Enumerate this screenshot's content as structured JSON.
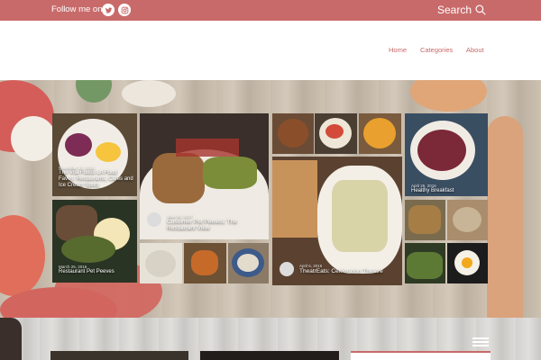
{
  "topbar": {
    "follow_label": "Follow me on",
    "social": [
      "twitter-icon",
      "instagram-icon"
    ],
    "search_label": "Search",
    "bg_color": "#c96a6a"
  },
  "nav": {
    "items": [
      "Home",
      "Categories",
      "About"
    ]
  },
  "hero": {
    "posts": [
      {
        "date": "November 23, 2016",
        "title": "The Vita Foods LA Food Faves: Restaurants, Cafes and Ice Cream Spots"
      },
      {
        "date": "June 26, 2017",
        "title": "Customer Pet Peeves: The Restaurant View"
      },
      {
        "date": "April 25, 2016",
        "title": "Healthy Breakfast"
      },
      {
        "date": "March 25, 2016",
        "title": "Restaurant Pet Peeves"
      },
      {
        "date": "April 6, 2016",
        "title": "TheatrEats: Celebration Theatre"
      }
    ]
  }
}
